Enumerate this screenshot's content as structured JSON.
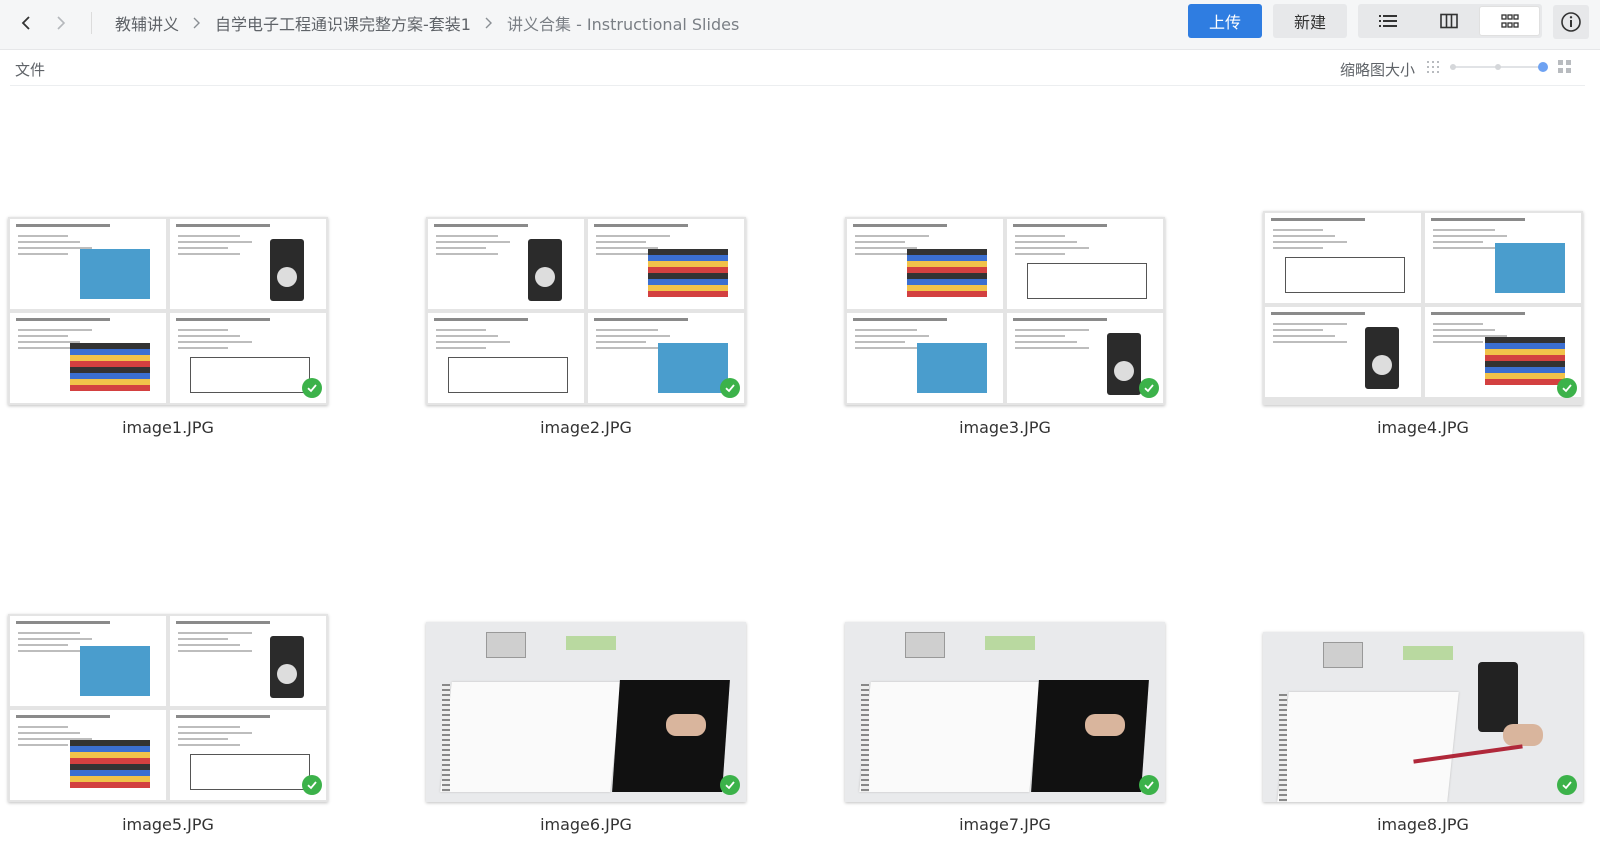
{
  "nav": {
    "breadcrumbs": [
      "教辅讲义",
      "自学电子工程通识课完整方案-套装1",
      "讲义合集 - Instructional Slides"
    ]
  },
  "toolbar": {
    "upload_label": "上传",
    "new_label": "新建"
  },
  "subheader": {
    "title": "文件",
    "thumb_size_label": "缩略图大小",
    "thumb_size_level": 1.0
  },
  "files": [
    {
      "name": "image1.JPG",
      "kind": "slides",
      "selected": true
    },
    {
      "name": "image2.JPG",
      "kind": "slides",
      "selected": true
    },
    {
      "name": "image3.JPG",
      "kind": "slides",
      "selected": true
    },
    {
      "name": "image4.JPG",
      "kind": "slides",
      "selected": true
    },
    {
      "name": "image5.JPG",
      "kind": "slides",
      "selected": true
    },
    {
      "name": "image6.JPG",
      "kind": "photo",
      "selected": true
    },
    {
      "name": "image7.JPG",
      "kind": "photo",
      "selected": true
    },
    {
      "name": "image8.JPG",
      "kind": "photo",
      "selected": true
    }
  ],
  "colors": {
    "accent": "#2f7de1",
    "check": "#3cb24a",
    "slider": "#6ea2f2"
  }
}
